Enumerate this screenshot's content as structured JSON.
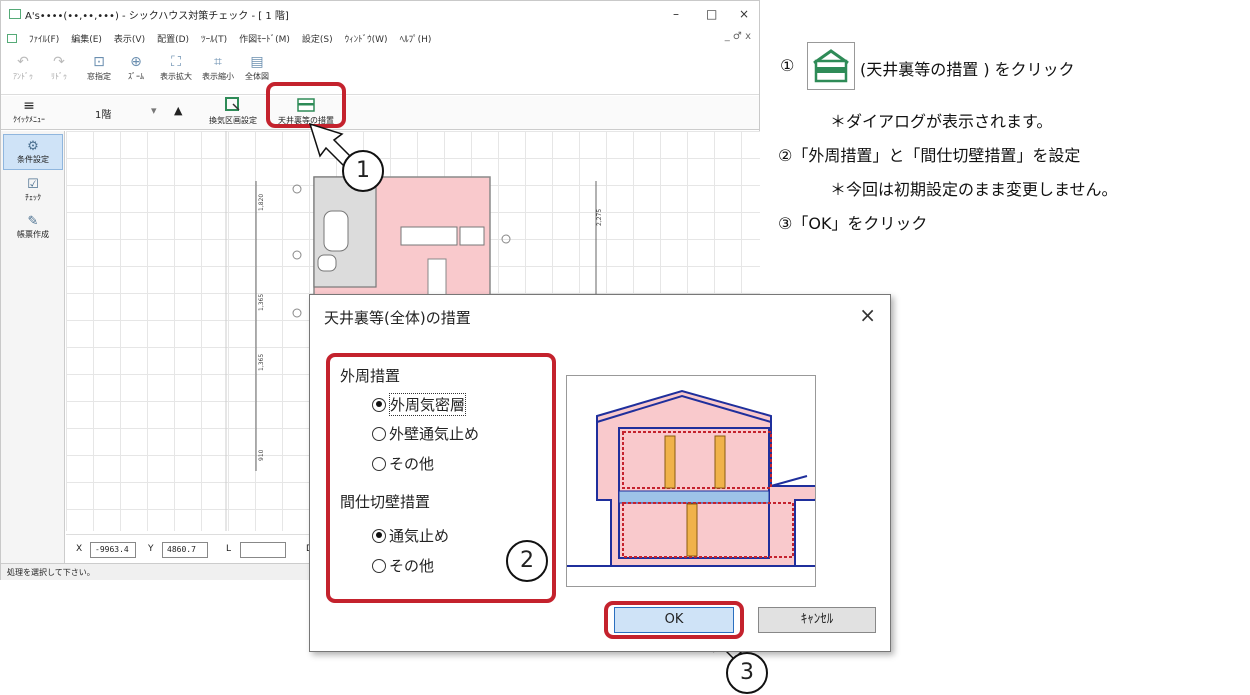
{
  "window": {
    "title": "A's••••(••,••,•••) - シックハウス対策チェック - [ 1 階]",
    "minimize": "–",
    "maximize": "□",
    "close": "×"
  },
  "menu": {
    "items": [
      "ﾌｧｲﾙ(F)",
      "編集(E)",
      "表示(V)",
      "配置(D)",
      "ﾂｰﾙ(T)",
      "作図ﾓｰﾄﾞ(M)",
      "設定(S)",
      "ｳｨﾝﾄﾞｳ(W)",
      "ﾍﾙﾌﾟ(H)"
    ],
    "mdi_controls": "_ ♂ x"
  },
  "toolbar": {
    "buttons": [
      {
        "label": "ｱﾝﾄﾞｩ",
        "icon": "undo-icon",
        "glyph": "↶"
      },
      {
        "label": "ﾘﾄﾞｩ",
        "icon": "redo-icon",
        "glyph": "↷"
      },
      {
        "label": "窓指定",
        "icon": "zoom-window-icon",
        "glyph": "⊡"
      },
      {
        "label": "ｽﾞｰﾑ",
        "icon": "zoom-icon",
        "glyph": "⊕"
      },
      {
        "label": "表示拡大",
        "icon": "zoom-in-icon",
        "glyph": "⛶"
      },
      {
        "label": "表示縮小",
        "icon": "zoom-out-icon",
        "glyph": "⌗"
      },
      {
        "label": "全体図",
        "icon": "overview-icon",
        "glyph": "▤"
      }
    ]
  },
  "toolbar2": {
    "quick_menu": "ｸｲｯｸﾒﾆｭｰ",
    "floor": "1階",
    "vent_zone": "換気区画設定",
    "ceiling_measure": "天井裏等の措置"
  },
  "sidebar": {
    "items": [
      {
        "label": "条件設定",
        "icon": "condition-settings-icon",
        "glyph": "⚙"
      },
      {
        "label": "ﾁｪｯｸ",
        "icon": "check-icon",
        "glyph": "☑"
      },
      {
        "label": "帳票作成",
        "icon": "report-icon",
        "glyph": "✎"
      }
    ]
  },
  "coords": {
    "x_label": "X",
    "x_value": "-9963.4",
    "y_label": "Y",
    "y_value": "4860.7",
    "l_label": "L",
    "l_value": "",
    "d_label": "D"
  },
  "status": "処理を選択して下さい。",
  "plan_labels": {
    "dims_left": [
      "1,820",
      "1,365",
      "1,365",
      "910"
    ],
    "dims_right": "2,275"
  },
  "dialog": {
    "title": "天井裏等(全体)の措置",
    "close": "×",
    "outer": {
      "label": "外周措置",
      "options": [
        "外周気密層",
        "外壁通気止め",
        "その他"
      ],
      "selected": 0
    },
    "partition": {
      "label": "間仕切壁措置",
      "options": [
        "通気止め",
        "その他"
      ],
      "selected": 0
    },
    "ok": "OK",
    "cancel": "ｷｬﾝｾﾙ"
  },
  "callouts": [
    "1",
    "2",
    "3"
  ],
  "instructions": {
    "step1_num": "①",
    "step1": "(天井裏等の措置 ) をクリック",
    "step1_note": "＊ダイアログが表示されます。",
    "step2": "②「外周措置」と「間仕切壁措置」を設定",
    "step2_note": "＊今回は初期設定のまま変更しません。",
    "step3": "③「OK」をクリック"
  },
  "colors": {
    "highlight": "#c4222d",
    "room_fill": "#f9c9cc",
    "house_outline": "#1f2f9c",
    "icon_green": "#2e8b57"
  }
}
